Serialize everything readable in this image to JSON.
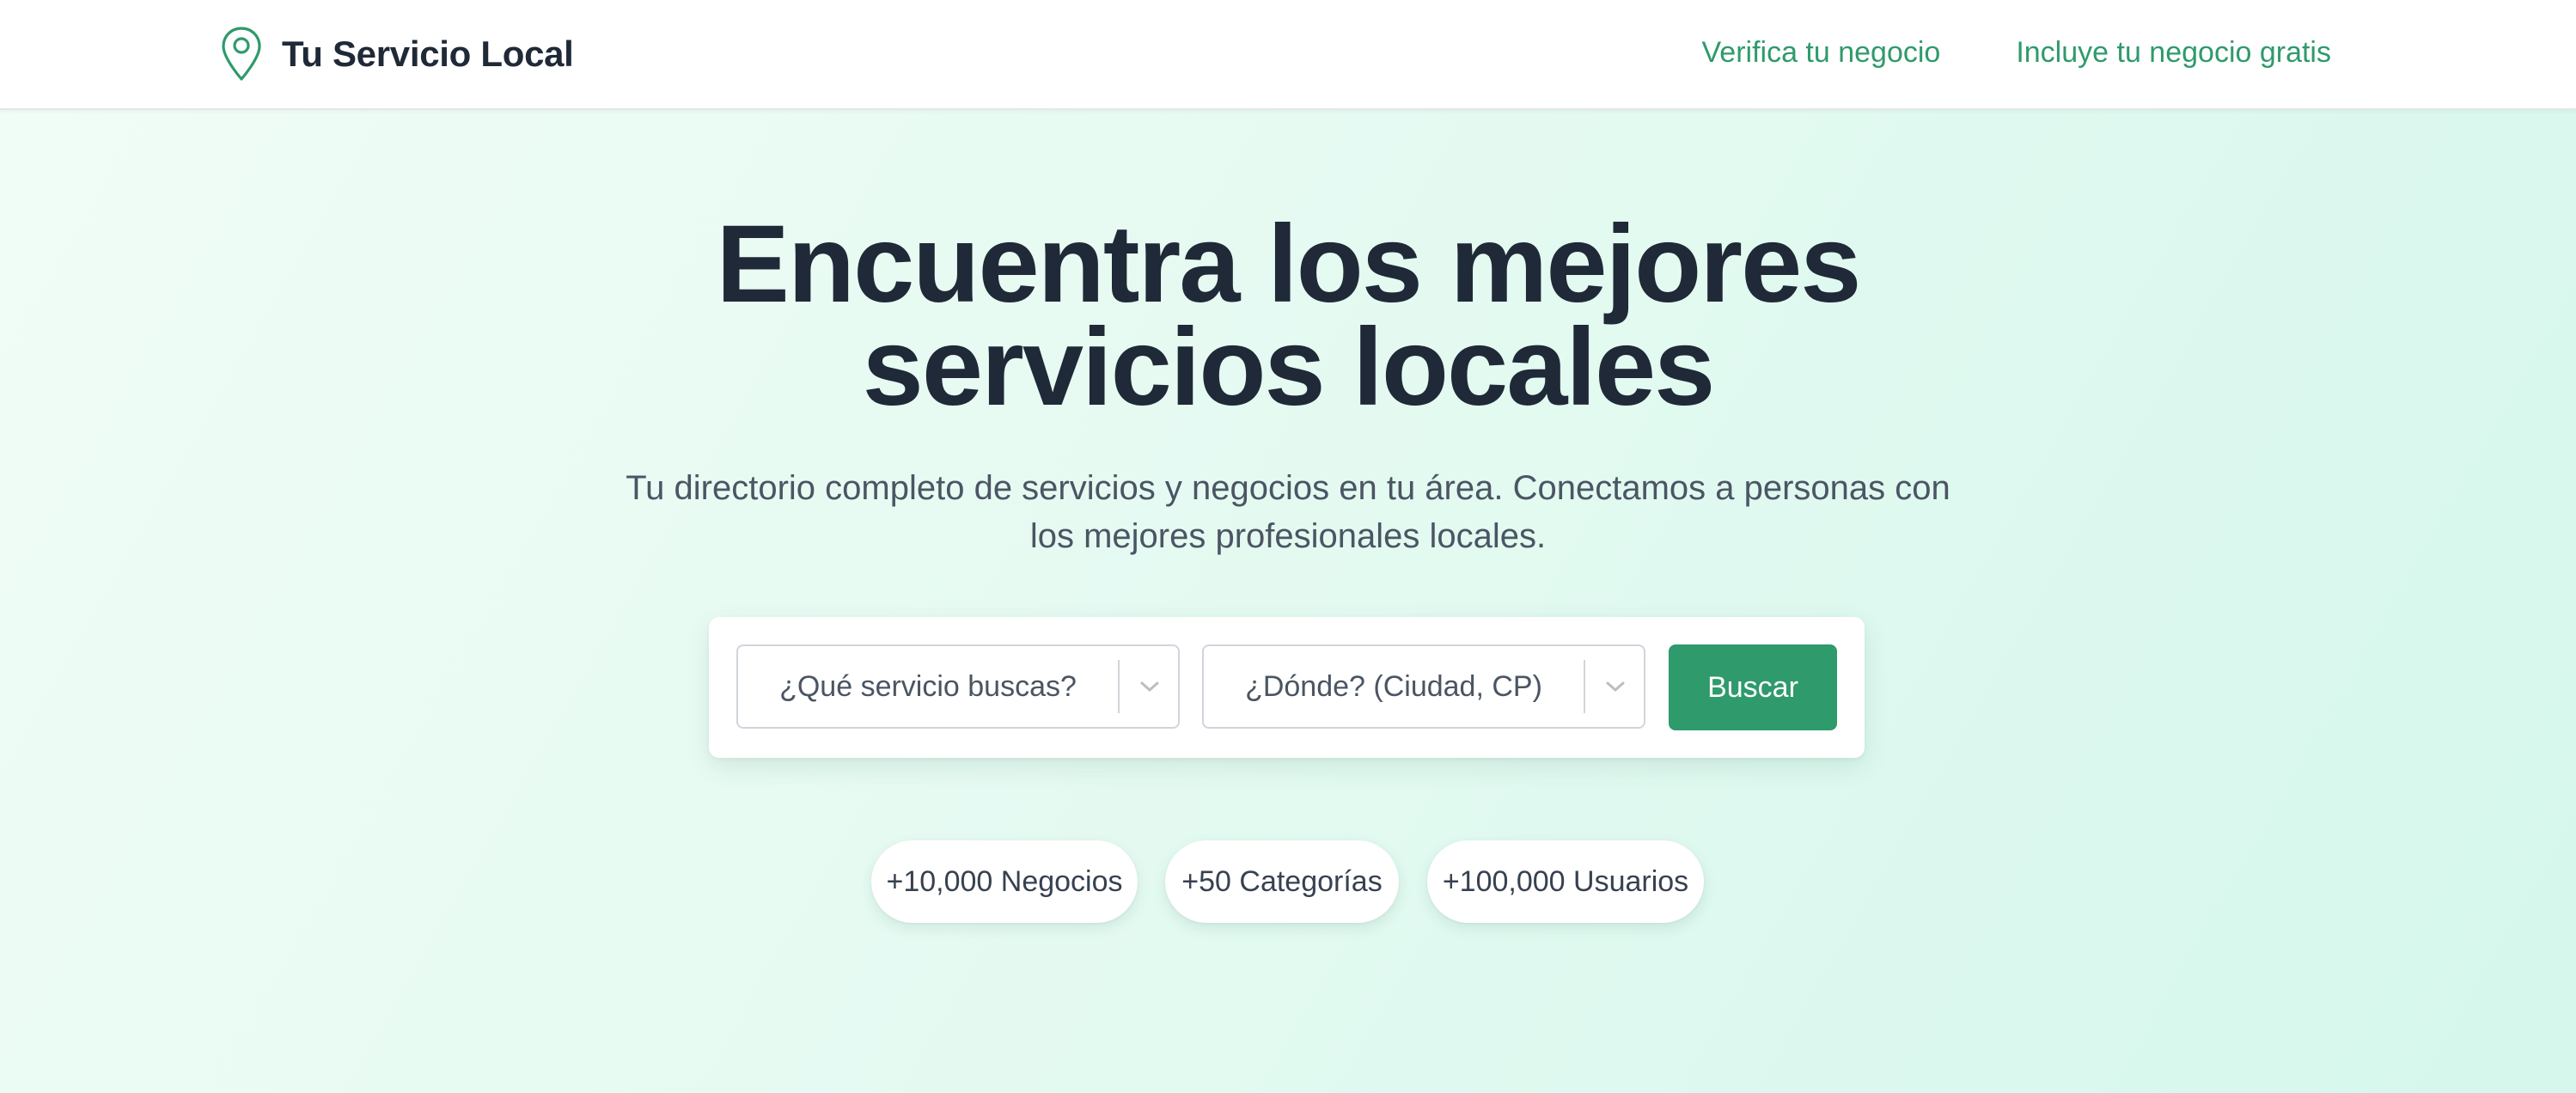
{
  "header": {
    "brand": "Tu Servicio Local",
    "logo_icon": "map-pin-icon",
    "nav": [
      {
        "label": "Verifica tu negocio"
      },
      {
        "label": "Incluye tu negocio gratis"
      }
    ]
  },
  "hero": {
    "title_line1": "Encuentra los mejores",
    "title_line2": "servicios locales",
    "subtitle": "Tu directorio completo de servicios y negocios en tu área. Conectamos a personas con los mejores profesionales locales."
  },
  "search": {
    "service_placeholder": "¿Qué servicio buscas?",
    "location_placeholder": "¿Dónde? (Ciudad, CP)",
    "button_label": "Buscar",
    "dropdown_icon": "chevron-down-icon"
  },
  "stats": [
    {
      "label": "+10,000 Negocios"
    },
    {
      "label": "+50 Categorías"
    },
    {
      "label": "+100,000 Usuarios"
    }
  ],
  "colors": {
    "accent": "#2f9a6b",
    "heading": "#1f2937",
    "body_text": "#4b5563",
    "background_start": "#f0fdf6",
    "background_end": "#d5f7ec"
  }
}
